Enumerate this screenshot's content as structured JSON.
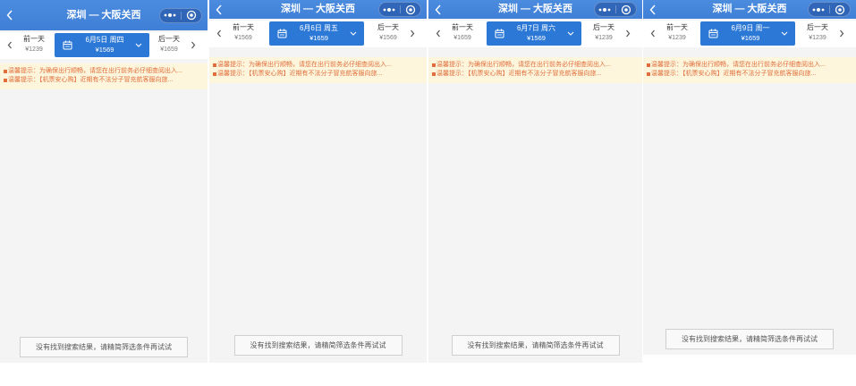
{
  "colors": {
    "header_blue": "#3f7fd6",
    "selected_blue": "#2c78d6",
    "page_bg": "#f4f4f4",
    "notice_bg": "#fdf6dc",
    "notice_text": "#e06d3b",
    "text_dark": "#333333",
    "text_muted": "#777777"
  },
  "icons": {
    "back": "back-chevron-icon",
    "more": "more-dots-icon",
    "close": "capsule-close-icon",
    "calendar": "calendar-icon",
    "dropdown": "chevron-down-icon",
    "prev": "chevron-left-icon",
    "next": "chevron-right-icon",
    "notice_bullet": "notice-bullet-icon"
  },
  "panels": [
    {
      "header": {
        "title": "深圳 — 大阪关西"
      },
      "date_nav": {
        "prev": {
          "label": "前一天",
          "price": "¥1239"
        },
        "current": {
          "date": "6月5日 周四",
          "price": "¥1569"
        },
        "next": {
          "label": "后一天",
          "price": "¥1659"
        }
      },
      "notices": [
        "温馨提示：为确保出行顺畅，请您在出行前务必仔细查阅出入...",
        "温馨提示：【机票安心购】近期有不法分子冒充航客服向旅..."
      ],
      "empty_message": "没有找到搜索结果，请精简筛选条件再试试"
    },
    {
      "header": {
        "title": "深圳 — 大阪关西"
      },
      "date_nav": {
        "prev": {
          "label": "前一天",
          "price": "¥1569"
        },
        "current": {
          "date": "6月6日 周五",
          "price": "¥1659"
        },
        "next": {
          "label": "后一天",
          "price": "¥1569"
        }
      },
      "notices": [
        "温馨提示：为确保出行顺畅，请您在出行前务必仔细查阅出入...",
        "温馨提示：【机票安心购】近期有不法分子冒充航客服向旅..."
      ],
      "empty_message": "没有找到搜索结果，请精简筛选条件再试试"
    },
    {
      "header": {
        "title": "深圳 — 大阪关西"
      },
      "date_nav": {
        "prev": {
          "label": "前一天",
          "price": "¥1659"
        },
        "current": {
          "date": "6月7日 周六",
          "price": "¥1569"
        },
        "next": {
          "label": "后一天",
          "price": "¥1239"
        }
      },
      "notices": [
        "温馨提示：为确保出行顺畅，请您在出行前务必仔细查阅出入...",
        "温馨提示：【机票安心购】近期有不法分子冒充航客服向旅..."
      ],
      "empty_message": "没有找到搜索结果，请精简筛选条件再试试"
    },
    {
      "header": {
        "title": "深圳 — 大阪关西"
      },
      "date_nav": {
        "prev": {
          "label": "前一天",
          "price": "¥1239"
        },
        "current": {
          "date": "6月9日 周一",
          "price": "¥1659"
        },
        "next": {
          "label": "后一天",
          "price": "¥1239"
        }
      },
      "notices": [
        "温馨提示：为确保出行顺畅，请您在出行前务必仔细查阅出入...",
        "温馨提示：【机票安心购】近期有不法分子冒充航客服向旅..."
      ],
      "empty_message": "没有找到搜索结果，请精简筛选条件再试试"
    }
  ]
}
